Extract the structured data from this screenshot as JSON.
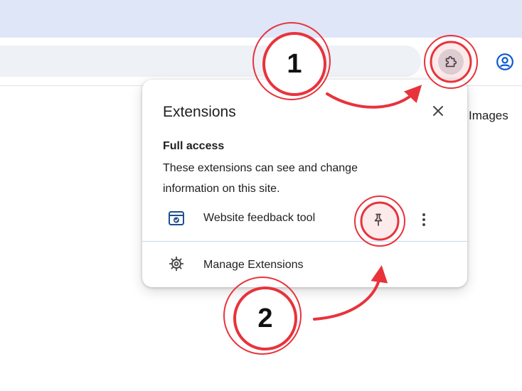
{
  "browser": {
    "page_link_text": "Images"
  },
  "popup": {
    "title": "Extensions",
    "full_access": {
      "heading": "Full access",
      "description": "These extensions can see and change information on this site."
    },
    "extensions": [
      {
        "name": "Website feedback tool",
        "icon": "browser-window-check-icon",
        "pinned": false
      }
    ],
    "manage_label": "Manage Extensions"
  },
  "annotations": {
    "step1_label": "1",
    "step2_label": "2",
    "color": "#e8333c"
  },
  "icons": {
    "extensions": "puzzle-icon",
    "profile": "profile-icon",
    "close": "close-icon",
    "pin": "pin-icon",
    "more": "more-vert-icon",
    "manage": "gear-icon"
  },
  "colors": {
    "tabstrip": "#dfe6f8",
    "omnibox": "#eef1f6",
    "icon_blue": "#1f4e8c",
    "profile_blue": "#0b57d0",
    "annotation_red": "#e8333c"
  }
}
